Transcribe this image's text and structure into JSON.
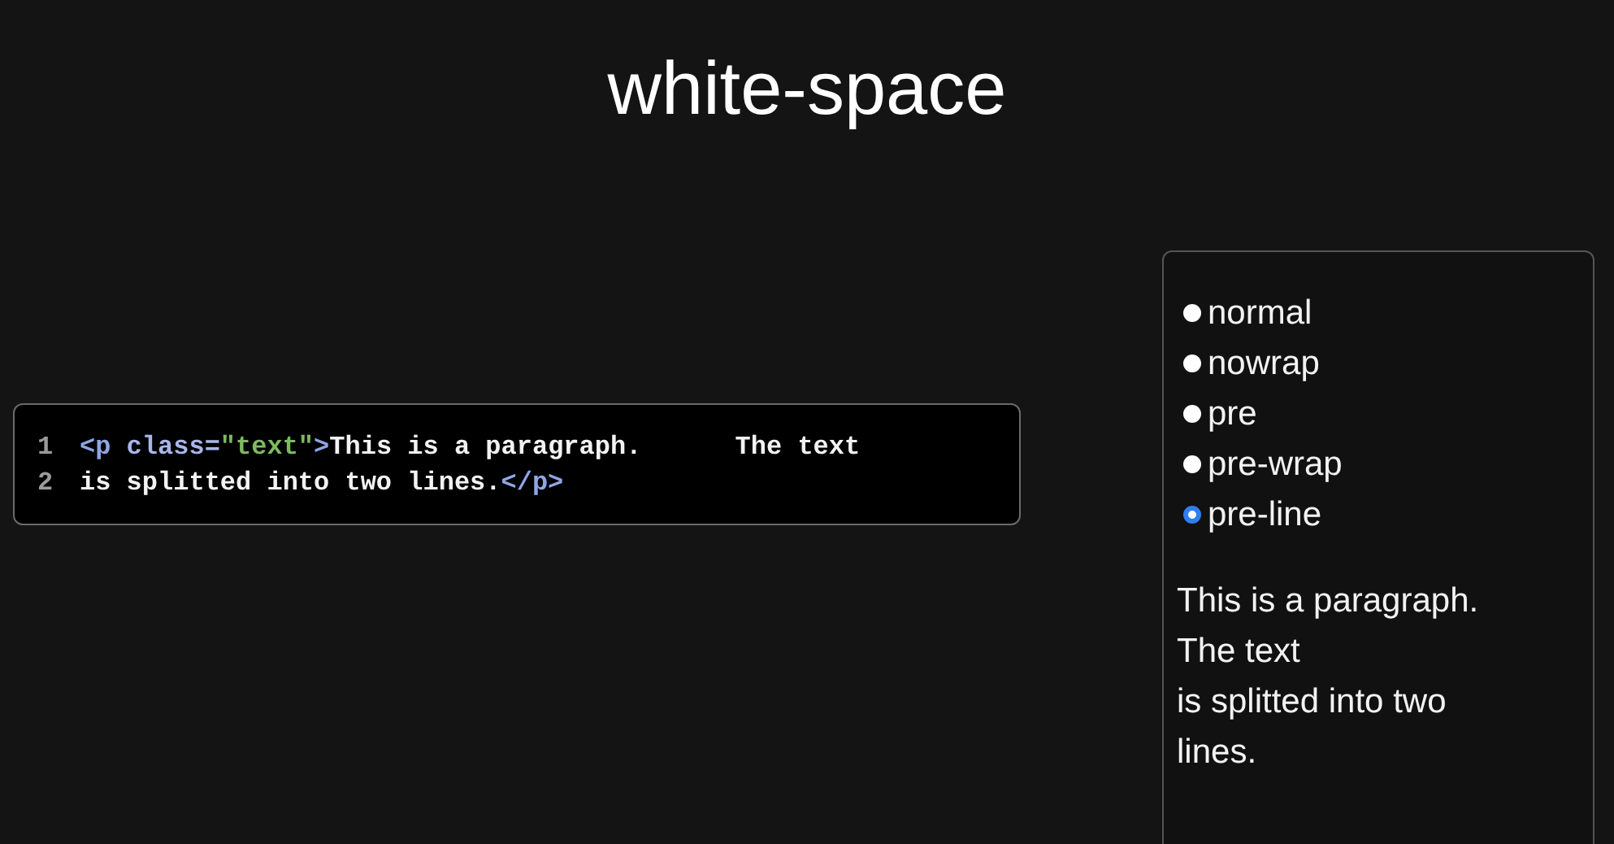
{
  "title": "white-space",
  "code": {
    "lines": [
      {
        "number": "1",
        "tokens": [
          {
            "kind": "tag",
            "text": "<p"
          },
          {
            "kind": "attr",
            "text": " class="
          },
          {
            "kind": "string",
            "text": "\"text\""
          },
          {
            "kind": "tag",
            "text": ">"
          },
          {
            "kind": "plain",
            "text": "This is a paragraph.      The text"
          }
        ]
      },
      {
        "number": "2",
        "tokens": [
          {
            "kind": "plain",
            "text": "is splitted into two lines."
          },
          {
            "kind": "tag",
            "text": "</p>"
          }
        ]
      }
    ]
  },
  "options": [
    {
      "label": "normal",
      "selected": false
    },
    {
      "label": "nowrap",
      "selected": false
    },
    {
      "label": "pre",
      "selected": false
    },
    {
      "label": "pre-wrap",
      "selected": false
    },
    {
      "label": "pre-line",
      "selected": true
    }
  ],
  "preview": {
    "lines": [
      "This is a paragraph.",
      "The text",
      "is splitted into two",
      "lines."
    ]
  }
}
